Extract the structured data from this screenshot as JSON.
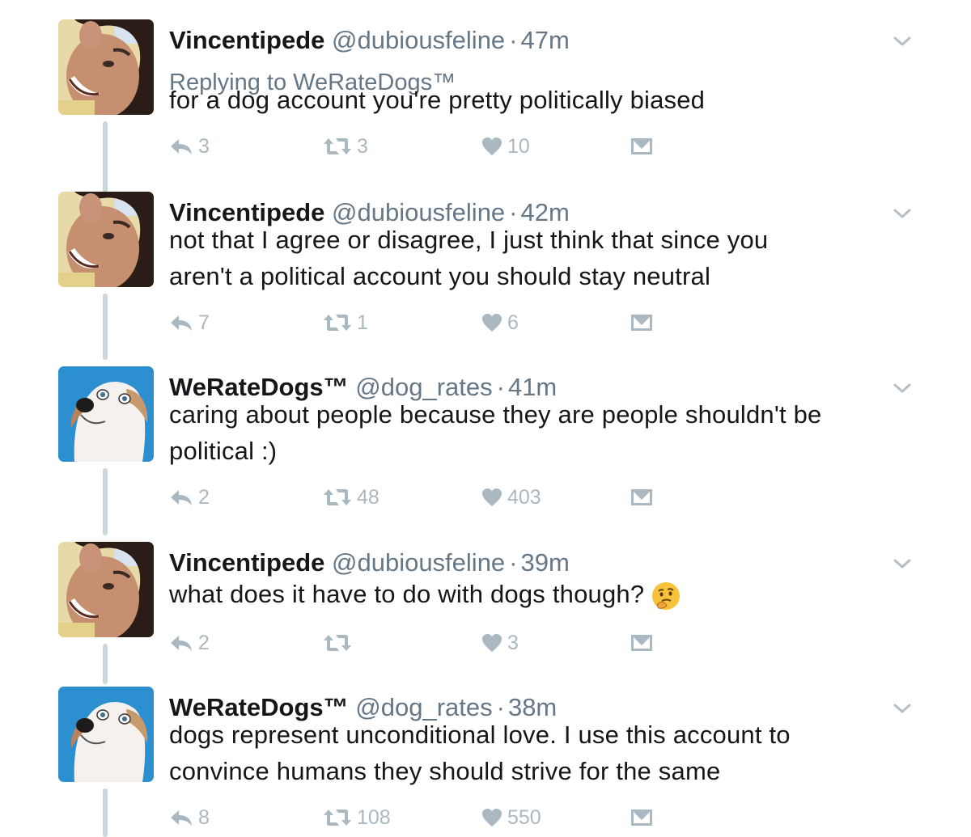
{
  "tweets": [
    {
      "name": "Vincentipede",
      "handle": "@dubiousfeline",
      "separator": "·",
      "time": "47m",
      "replying_to": "Replying to WeRateDogs™",
      "text": "for a dog account you're pretty politically biased",
      "replies": "3",
      "retweets": "3",
      "likes": "10",
      "avatar_icon": "person-avatar"
    },
    {
      "name": "Vincentipede",
      "handle": "@dubiousfeline",
      "separator": "·",
      "time": "42m",
      "text_line1": "not that I agree or disagree, I just think that since you",
      "text_line2": "aren't a political account you should stay neutral",
      "replies": "7",
      "retweets": "1",
      "likes": "6",
      "avatar_icon": "person-avatar"
    },
    {
      "name": "WeRateDogs™",
      "handle": "@dog_rates",
      "separator": "·",
      "time": "41m",
      "text_line1": "caring about people because they are people shouldn't be",
      "text_line2": "political :)",
      "replies": "2",
      "retweets": "48",
      "likes": "403",
      "avatar_icon": "dog-avatar"
    },
    {
      "name": "Vincentipede",
      "handle": "@dubiousfeline",
      "separator": "·",
      "time": "39m",
      "text": "what does it have to do with dogs though?",
      "emoji_icon": "thinking-face-icon",
      "replies": "2",
      "retweets": "",
      "likes": "3",
      "avatar_icon": "person-avatar"
    },
    {
      "name": "WeRateDogs™",
      "handle": "@dog_rates",
      "separator": "·",
      "time": "38m",
      "text_line1": "dogs represent unconditional love. I use this account to",
      "text_line2": "convince humans they should strive for the same",
      "replies": "8",
      "retweets": "108",
      "likes": "550",
      "avatar_icon": "dog-avatar"
    }
  ],
  "colors": {
    "name": "#14171a",
    "meta": "#657786",
    "action": "#aab8c2",
    "thread_line": "#ccd6dd",
    "dog_background": "#2b8fd0"
  }
}
